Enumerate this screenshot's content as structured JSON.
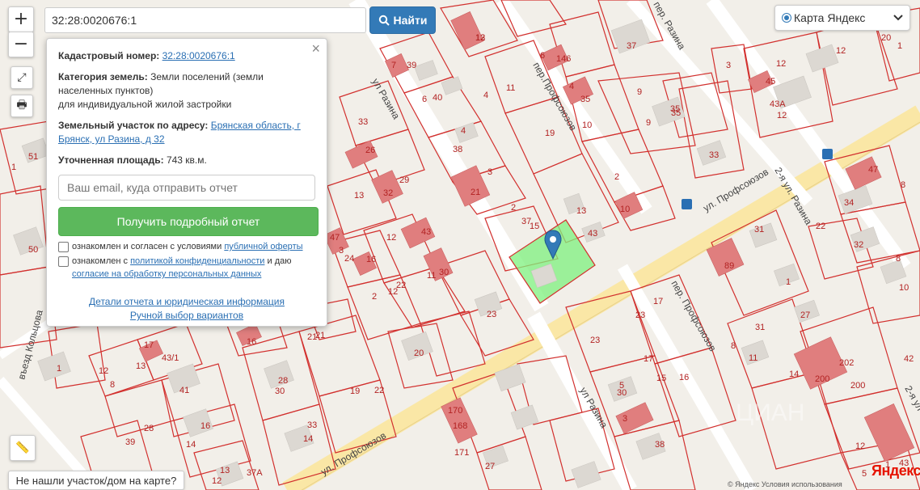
{
  "search": {
    "value": "32:28:0020676:1",
    "button_label": "Найти"
  },
  "zoom": {
    "in": "+",
    "out": "−"
  },
  "layer": {
    "label": "Карта Яндекс"
  },
  "popup": {
    "cad_label": "Кадастровый номер:",
    "cad_value": "32:28:0020676:1",
    "category_label": "Категория земель:",
    "category_value1": "Земли поселений (земли",
    "category_value2": "населенных пунктов)",
    "category_value3": "для индивидуальной жилой застройки",
    "address_label": "Земельный участок по адресу:",
    "address_value1": "Брянская область, г",
    "address_value2": "Брянск, ул Разина, д 32",
    "area_label": "Уточненная площадь:",
    "area_value": "743 кв.м.",
    "email_placeholder": "Ваш email, куда отправить отчет",
    "report_button": "Получить подробный отчет",
    "consent1_text": "ознакомлен и согласен с условиями",
    "consent1_link": "публичной оферты",
    "consent2_text": "ознакомлен с",
    "consent2_link": "политикой конфиденциальности",
    "consent2_tail": "и даю",
    "consent2_link2": "согласие на обработку персональных данных",
    "link_details": "Детали отчета и юридическая информация",
    "link_manual": "Ручной выбор вариантов",
    "close": "×"
  },
  "not_found": "Не нашли участок/дом на карте?",
  "yandex": "Яндекс",
  "copyright": "© Яндекс  Условия использования",
  "streets": {
    "razina1": "ул Разина",
    "razina2": "ул Разина",
    "profsoyuzov1": "ул. Профсоюзов",
    "profsoyuzov2": "ул. Профсоюзов",
    "per_prof1": "пер.Профсоюзов",
    "per_prof2": "пер. Профсоюзов",
    "per_razina": "пер. Разина",
    "razina2nd": "2-я ул. Разина",
    "razina2nd_b": "2-я ул",
    "koltsova": "въезд Кольцова"
  },
  "labels": [
    "12",
    "7",
    "39",
    "6",
    "40",
    "4",
    "11",
    "6",
    "146",
    "4",
    "35",
    "10",
    "9",
    "35",
    "37",
    "3",
    "12",
    "45",
    "43А",
    "12",
    "20",
    "12",
    "51",
    "1",
    "26",
    "33",
    "4",
    "38",
    "3",
    "21",
    "19",
    "2",
    "33",
    "9",
    "47",
    "34",
    "13",
    "32",
    "29",
    "2",
    "13",
    "15",
    "37",
    "43",
    "1",
    "47",
    "10",
    "31",
    "50",
    "3",
    "12",
    "43",
    "24",
    "16",
    "12",
    "11",
    "30",
    "8",
    "32",
    "22",
    "2",
    "23",
    "10",
    "17",
    "23",
    "35",
    "17",
    "23",
    "31",
    "89",
    "8",
    "22",
    "27",
    "1",
    "43",
    "20",
    "16",
    "21",
    "17",
    "1",
    "12",
    "13",
    "8",
    "43/1",
    "41",
    "28",
    "30",
    "19",
    "22",
    "21",
    "170",
    "168",
    "171",
    "5",
    "30",
    "3",
    "38",
    "16",
    "39",
    "14",
    "33",
    "14",
    "28",
    "13",
    "37А",
    "27",
    "15",
    "16",
    "8",
    "11",
    "14",
    "200",
    "202",
    "200",
    "43",
    "12",
    "5",
    "1",
    "12",
    "42",
    "13"
  ]
}
